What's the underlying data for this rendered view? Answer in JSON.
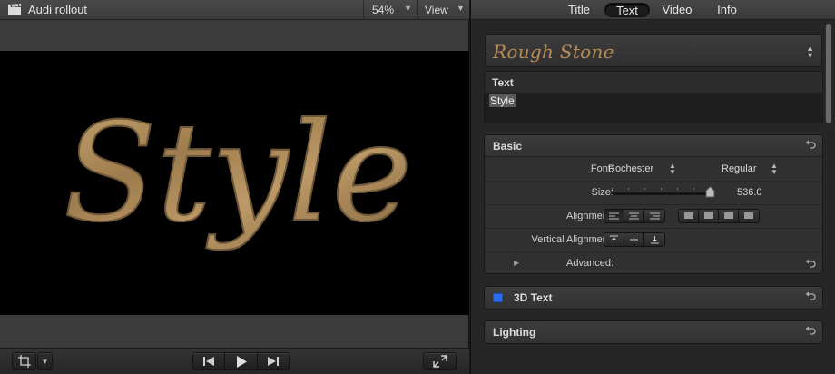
{
  "viewer": {
    "title": "Audi rollout",
    "zoom": "54%",
    "view_menu": "View",
    "canvas_text": "Style"
  },
  "inspector": {
    "tabs": [
      {
        "label": "Title",
        "active": false
      },
      {
        "label": "Text",
        "active": true
      },
      {
        "label": "Video",
        "active": false
      },
      {
        "label": "Info",
        "active": false
      }
    ],
    "preset": "Rough Stone",
    "text_section": {
      "header": "Text",
      "value": "Style"
    },
    "basic": {
      "title": "Basic",
      "font_label": "Font:",
      "font_family": "Rochester",
      "font_style": "Regular",
      "size_label": "Size:",
      "size_value": "536.0",
      "size_fraction": 0.95,
      "alignment_label": "Alignment:",
      "vertical_alignment_label": "Vertical Alignment:",
      "advanced_label": "Advanced:"
    },
    "three_d": {
      "title": "3D Text",
      "enabled": true
    },
    "lighting": {
      "title": "Lighting"
    }
  },
  "colors": {
    "accent_blue": "#2a6df0",
    "gold": "#b88c58",
    "canvas_bg": "#000000"
  }
}
